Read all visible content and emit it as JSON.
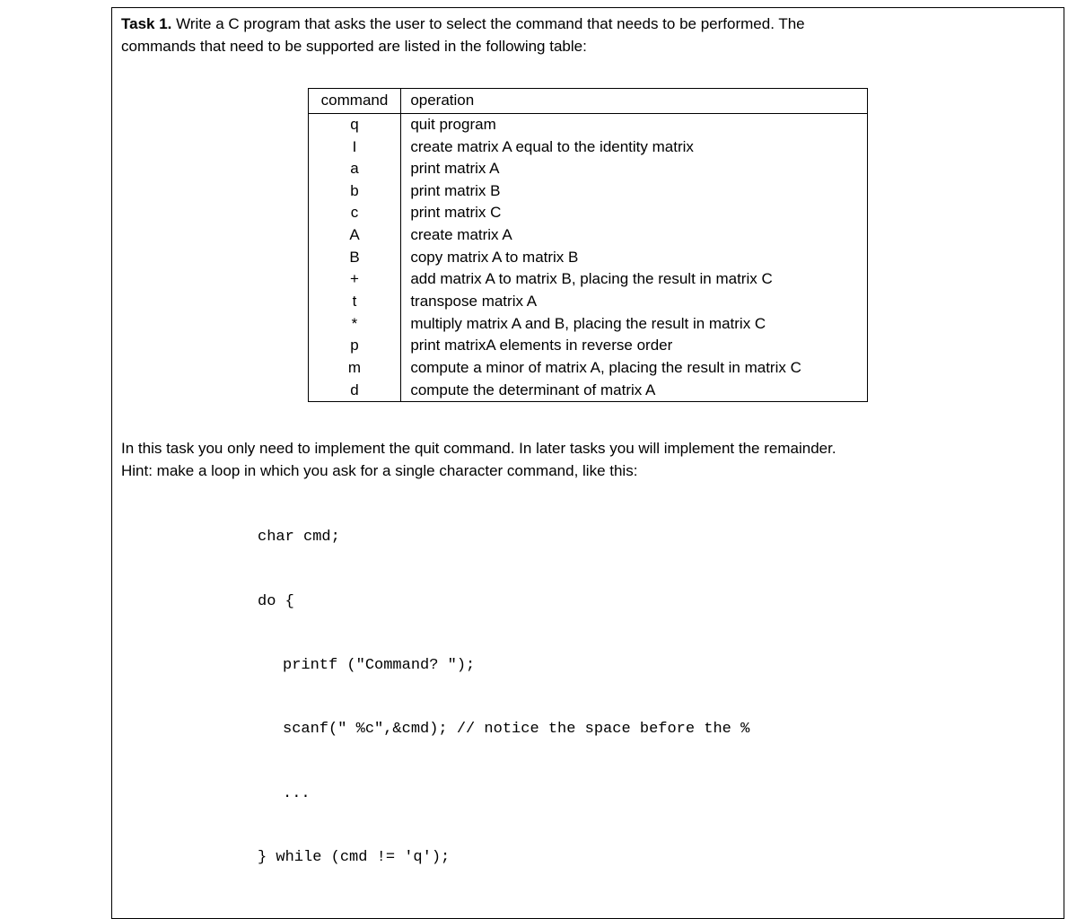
{
  "task": {
    "title": "Task 1.",
    "prompt_line1": " Write a C program that asks the user to select the command that needs to be performed. The",
    "prompt_line2": "commands that need to be supported are listed in the following table:"
  },
  "table": {
    "headers": {
      "cmd": "command",
      "op": "operation"
    },
    "rows": [
      {
        "cmd": "q",
        "op": "quit program"
      },
      {
        "cmd": "I",
        "op": "create matrix A equal to the identity matrix"
      },
      {
        "cmd": "a",
        "op": "print matrix A"
      },
      {
        "cmd": "b",
        "op": "print matrix B"
      },
      {
        "cmd": "c",
        "op": "print matrix C"
      },
      {
        "cmd": "A",
        "op": "create matrix A"
      },
      {
        "cmd": "B",
        "op": "copy matrix A to matrix B"
      },
      {
        "cmd": "+",
        "op": "add matrix A to matrix B, placing the result in matrix C"
      },
      {
        "cmd": "t",
        "op": "transpose matrix A"
      },
      {
        "cmd": "*",
        "op": "multiply matrix A and B, placing the result in matrix C"
      },
      {
        "cmd": "p",
        "op": "print matrixA elements in reverse order"
      },
      {
        "cmd": "m",
        "op": "compute a minor of matrix A, placing the result in matrix C"
      },
      {
        "cmd": "d",
        "op": "compute the determinant of matrix A"
      }
    ]
  },
  "body": {
    "line1": "In this task you only need to implement the quit command. In later tasks you will implement the remainder.",
    "line2": "Hint: make a loop in which you ask for a single character command, like this:"
  },
  "code": {
    "l1": "char cmd;",
    "l2": "do {",
    "l3": "printf (\"Command? \");",
    "l4": "scanf(\" %c\",&cmd); // notice the space before the %",
    "l5": "...",
    "l6": "} while (cmd != 'q');"
  }
}
